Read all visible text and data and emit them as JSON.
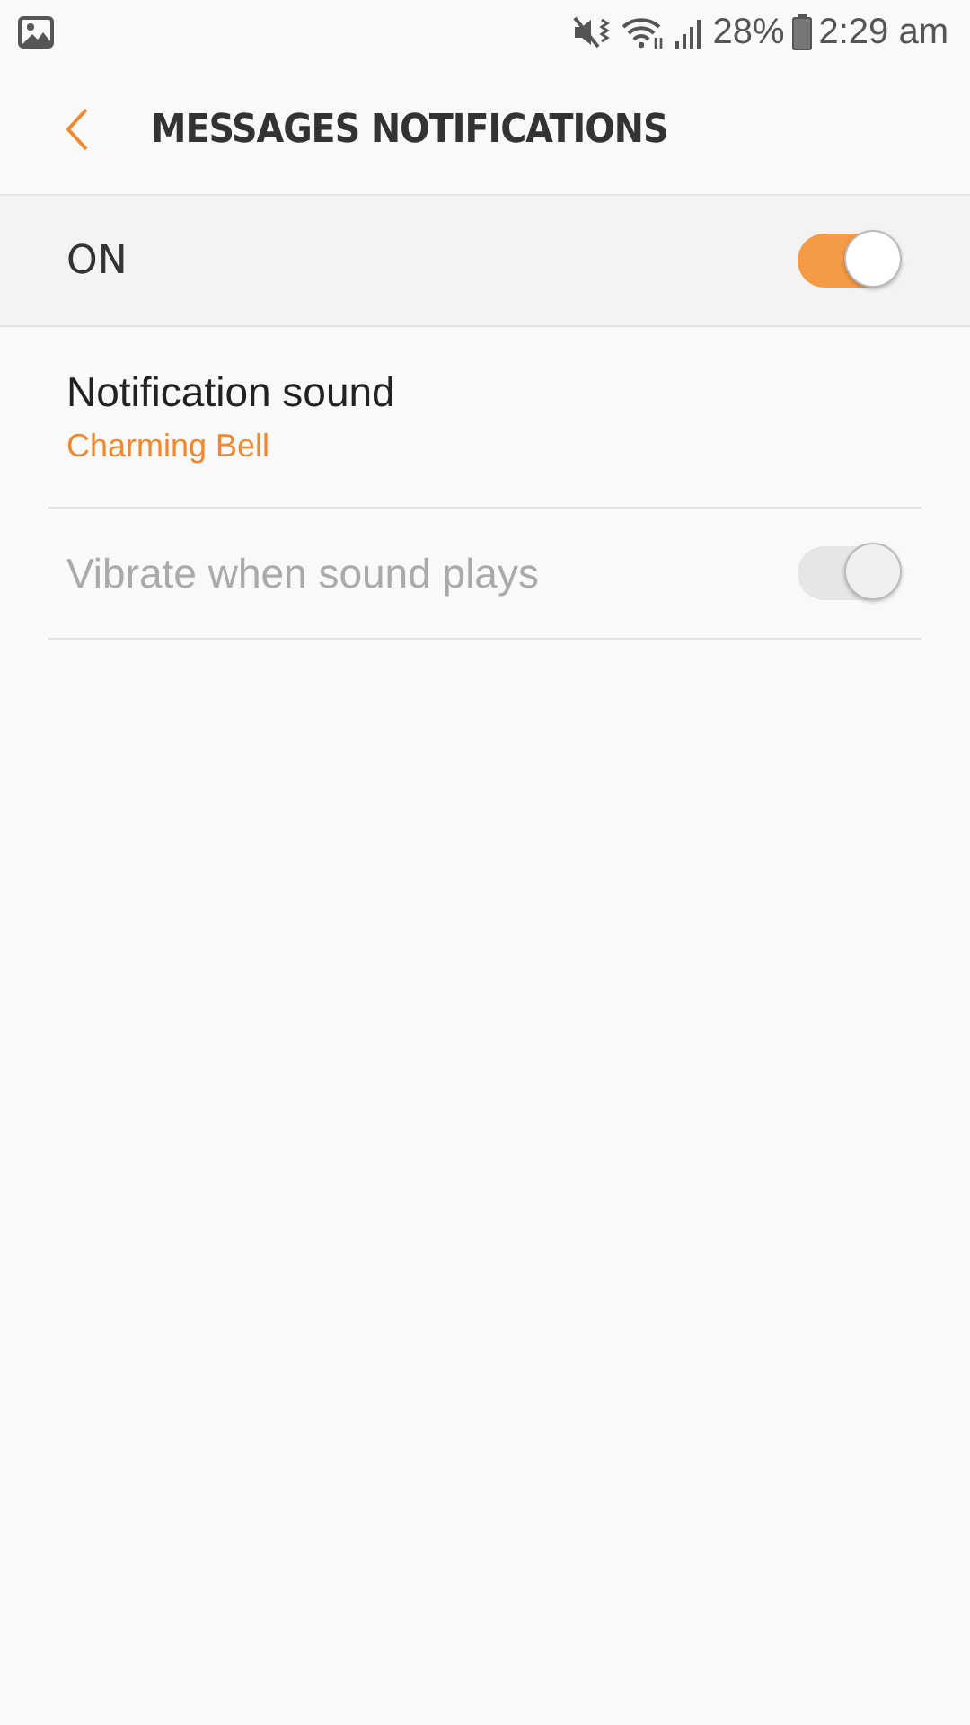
{
  "status_bar": {
    "battery": "28%",
    "time": "2:29 am"
  },
  "header": {
    "title": "MESSAGES NOTIFICATIONS"
  },
  "master_switch": {
    "label": "ON",
    "on": true
  },
  "settings": [
    {
      "kind": "value",
      "title": "Notification sound",
      "value": "Charming Bell",
      "disabled": false
    },
    {
      "kind": "toggle",
      "title": "Vibrate when sound plays",
      "on": true,
      "disabled": true
    }
  ]
}
